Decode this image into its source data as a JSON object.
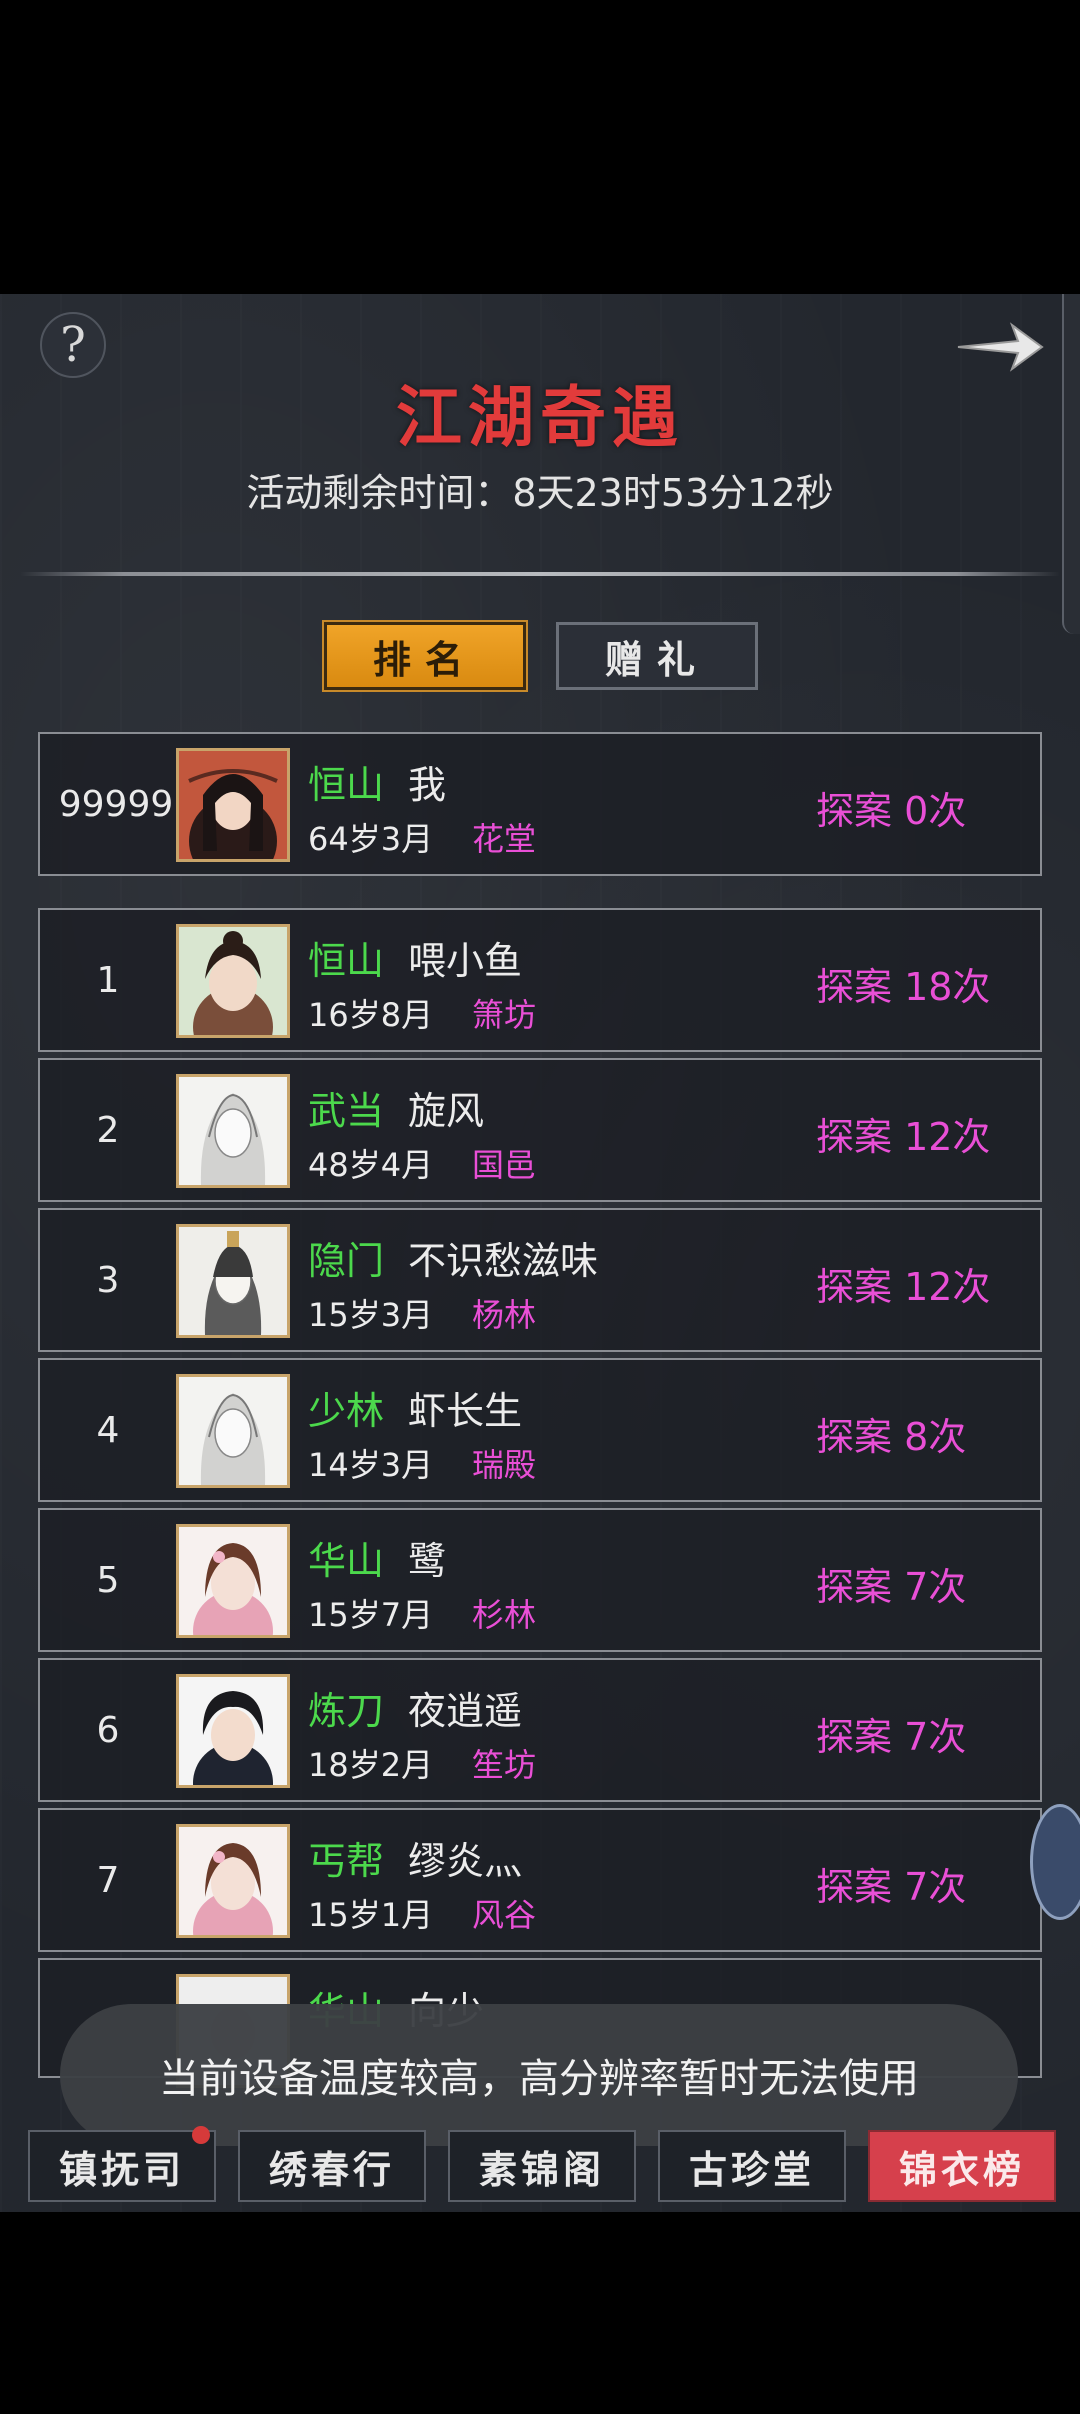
{
  "header": {
    "title": "江湖奇遇",
    "countdown": "活动剩余时间：8天23时53分12秒",
    "help_icon": "question-icon",
    "next_icon": "arrow-right-icon"
  },
  "tabs": {
    "ranking": "排名",
    "gift": "赠礼"
  },
  "self_row": {
    "rank": "99999",
    "sect": "恒山",
    "name": "我",
    "age": "64岁3月",
    "place": "花堂",
    "explore": "探案 0次"
  },
  "rows": [
    {
      "rank": "1",
      "sect": "恒山",
      "name": "喂小鱼",
      "age": "16岁8月",
      "place": "箫坊",
      "explore": "探案 18次"
    },
    {
      "rank": "2",
      "sect": "武当",
      "name": "旋风",
      "age": "48岁4月",
      "place": "国邑",
      "explore": "探案 12次"
    },
    {
      "rank": "3",
      "sect": "隐门",
      "name": "不识愁滋味",
      "age": "15岁3月",
      "place": "杨林",
      "explore": "探案 12次"
    },
    {
      "rank": "4",
      "sect": "少林",
      "name": "虾长生",
      "age": "14岁3月",
      "place": "瑞殿",
      "explore": "探案 8次"
    },
    {
      "rank": "5",
      "sect": "华山",
      "name": "鹭",
      "age": "15岁7月",
      "place": "杉林",
      "explore": "探案 7次"
    },
    {
      "rank": "6",
      "sect": "炼刀",
      "name": "夜逍遥",
      "age": "18岁2月",
      "place": "笙坊",
      "explore": "探案 7次"
    },
    {
      "rank": "7",
      "sect": "丐帮",
      "name": "缪炎灬",
      "age": "15岁1月",
      "place": "风谷",
      "explore": "探案 7次"
    },
    {
      "rank": "",
      "sect": "华山",
      "name": "向少",
      "age": "",
      "place": "",
      "explore": ""
    }
  ],
  "toast": "当前设备温度较高，高分辨率暂时无法使用",
  "bottom_nav": [
    "镇抚司",
    "绣春行",
    "素锦阁",
    "古珍堂",
    "锦衣榜"
  ],
  "colors": {
    "title": "#e23b3b",
    "sect": "#4cd94c",
    "accent_pink": "#e94fd6",
    "tab_active": "#f0a428",
    "nav_active": "#d6404c"
  }
}
